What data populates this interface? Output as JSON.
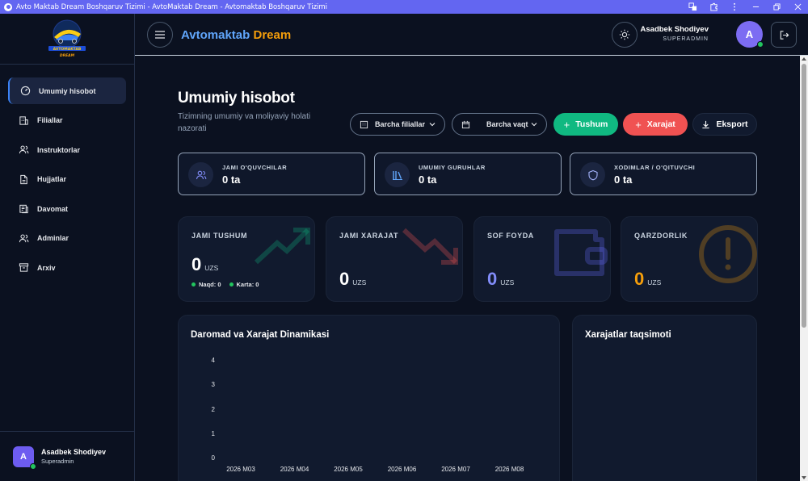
{
  "window": {
    "title": "Avto Maktab Dream Boshqaruv Tizimi - AvtoMaktab Dream - Avtomaktab Boshqaruv Tizimi"
  },
  "logo": {
    "text": "AVTOMAKTAB",
    "subtext": "DREAM"
  },
  "sidebar": {
    "items": [
      {
        "label": "Umumiy hisobot",
        "icon": "dashboard-icon",
        "active": true
      },
      {
        "label": "Filiallar",
        "icon": "building-icon"
      },
      {
        "label": "Instruktorlar",
        "icon": "users-icon"
      },
      {
        "label": "Hujjatlar",
        "icon": "document-icon"
      },
      {
        "label": "Davomat",
        "icon": "calendar-check-icon"
      },
      {
        "label": "Adminlar",
        "icon": "admin-users-icon"
      },
      {
        "label": "Arxiv",
        "icon": "archive-icon"
      }
    ],
    "user": {
      "initial": "A",
      "name": "Asadbek Shodiyev",
      "role": "Superadmin"
    }
  },
  "header": {
    "brand_part1": "Avtomaktab",
    "brand_part2": "Dream",
    "user": {
      "initial": "A",
      "name": "Asadbek Shodiyev",
      "role": "SUPERADMIN"
    }
  },
  "page": {
    "title": "Umumiy hisobot",
    "subtitle": "Tizimning umumiy va moliyaviy holati nazorati"
  },
  "filters": {
    "branch": "Barcha filiallar",
    "period": "Barcha vaqt"
  },
  "actions": {
    "income": "Tushum",
    "expense": "Xarajat",
    "export": "Eksport"
  },
  "stats": [
    {
      "label": "JAMI O'QUVCHILAR",
      "value": "0 ta",
      "icon": "users-icon"
    },
    {
      "label": "UMUMIY GURUHLAR",
      "value": "0 ta",
      "icon": "library-icon"
    },
    {
      "label": "XODIMLAR / O'QITUVCHI",
      "value": "0 ta",
      "icon": "shield-icon"
    }
  ],
  "finance": [
    {
      "label": "JAMI TUSHUM",
      "value": "0",
      "unit": "UZS",
      "cash_label": "Naqd:",
      "cash": "0",
      "card_label": "Karta:",
      "card": "0",
      "value_color": "#ffffff"
    },
    {
      "label": "JAMI XARAJAT",
      "value": "0",
      "unit": "UZS",
      "value_color": "#ffffff"
    },
    {
      "label": "SOF FOYDA",
      "value": "0",
      "unit": "UZS",
      "value_color": "#818cf8"
    },
    {
      "label": "QARZDORLIK",
      "value": "0",
      "unit": "UZS",
      "value_color": "#f59e0b"
    }
  ],
  "colors": {
    "accent": "#6366f1",
    "income": "#10b981",
    "expense": "#f05252",
    "brand_blue": "#60a5fa",
    "brand_orange": "#f59e0b",
    "online": "#22c55e"
  },
  "charts": {
    "dynamics_title": "Daromad va Xarajat Dinamikasi",
    "distribution_title": "Xarajatlar taqsimoti"
  },
  "chart_data": {
    "type": "line",
    "title": "Daromad va Xarajat Dinamikasi",
    "x": [
      "2026 M03",
      "2026 M04",
      "2026 M05",
      "2026 M06",
      "2026 M07",
      "2026 M08"
    ],
    "series": [],
    "yticks": [
      "0",
      "1",
      "2",
      "3",
      "4"
    ],
    "ylim": [
      0,
      4
    ]
  }
}
